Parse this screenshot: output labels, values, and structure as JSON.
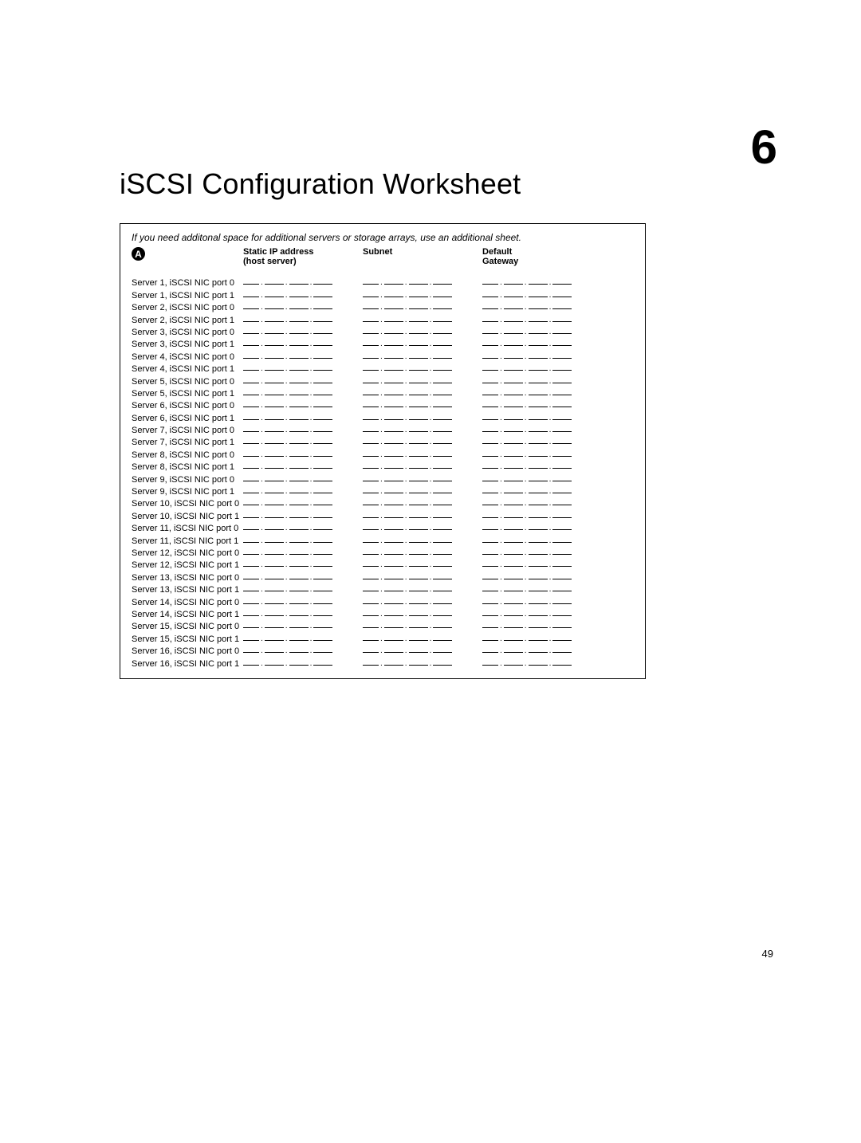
{
  "chapter_number": "6",
  "title": "iSCSI Configuration Worksheet",
  "note": "If you need additonal space for additional servers or storage arrays, use an additional sheet.",
  "badge": "A",
  "headers": {
    "static_ip_line1": "Static IP address",
    "static_ip_line2": "(host server)",
    "subnet": "Subnet",
    "gateway_line1": "Default",
    "gateway_line2": "Gateway"
  },
  "rows": [
    "Server 1, iSCSI NIC port 0",
    "Server 1, iSCSI NIC port 1",
    "Server 2, iSCSI NIC port 0",
    "Server 2, iSCSI NIC port 1",
    "Server 3, iSCSI NIC port 0",
    "Server 3, iSCSI NIC port 1",
    "Server 4, iSCSI NIC port 0",
    "Server 4, iSCSI NIC port 1",
    "Server 5, iSCSI NIC port 0",
    "Server 5, iSCSI NIC port 1",
    "Server 6, iSCSI NIC port 0",
    "Server 6, iSCSI NIC port 1",
    "Server 7, iSCSI NIC port 0",
    "Server 7, iSCSI NIC port 1",
    "Server 8, iSCSI NIC port 0",
    "Server 8, iSCSI NIC port 1",
    "Server 9, iSCSI NIC port 0",
    "Server 9, iSCSI NIC port 1",
    "Server 10, iSCSI NIC port 0",
    "Server 10, iSCSI NIC port 1",
    "Server 11, iSCSI NIC port 0",
    "Server 11, iSCSI NIC port 1",
    "Server 12, iSCSI NIC port 0",
    "Server 12, iSCSI NIC port 1",
    "Server 13, iSCSI NIC port 0",
    "Server 13, iSCSI NIC port 1",
    "Server 14, iSCSI NIC port 0",
    "Server 14, iSCSI NIC port 1",
    "Server 15, iSCSI NIC port 0",
    "Server 15, iSCSI NIC port 1",
    "Server 16, iSCSI NIC port 0",
    "Server 16, iSCSI NIC port 1"
  ],
  "page_number": "49"
}
